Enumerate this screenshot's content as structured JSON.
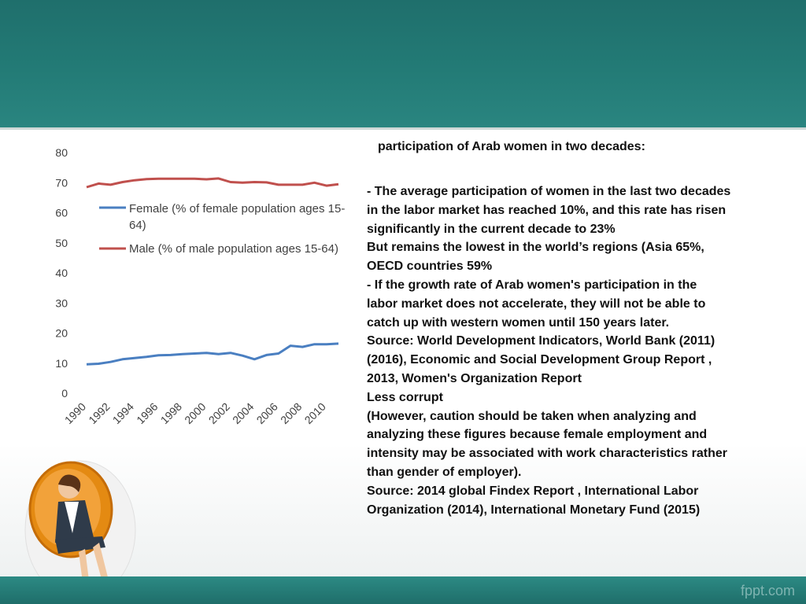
{
  "slide": {
    "heading": "participation of Arab women in two decades:",
    "body_lines": [
      "- The average participation of women in the last two decades",
      "in the labor market has reached 10%, and this rate has risen",
      "significantly in the current decade to 23%",
      "But remains the lowest in the world’s regions  (Asia 65%,",
      "OECD countries 59%",
      "- If the growth rate of Arab women's participation in the",
      "labor market does not accelerate, they will not be able to",
      "catch up with  western women  until 150 years later.",
      "Source: World Development Indicators, World Bank (2011)",
      "(2016),   Economic and Social Development Group Report ,",
      "2013,  Women's Organization Report",
      "Less corrupt",
      "(However, caution should be taken when analyzing and",
      "analyzing these figures because female employment and",
      "intensity may be associated with work characteristics rather",
      "than gender of employer).",
      "Source: 2014 global Findex Report , International Labor",
      "Organization (2014), International Monetary Fund (2015)"
    ],
    "footer_brand": "fppt.com"
  },
  "colors": {
    "header": "#237b76",
    "female_series": "#4a7fc1",
    "male_series": "#c0504d"
  },
  "chart_data": {
    "type": "line",
    "x": [
      1990,
      1991,
      1992,
      1993,
      1994,
      1995,
      1996,
      1997,
      1998,
      1999,
      2000,
      2001,
      2002,
      2003,
      2004,
      2005,
      2006,
      2007,
      2008,
      2009,
      2010,
      2011
    ],
    "x_tick_labels": [
      "1990",
      "1992",
      "1994",
      "1996",
      "1998",
      "2000",
      "2002",
      "2004",
      "2006",
      "2008",
      "2010"
    ],
    "y_tick_labels": [
      "0",
      "10",
      "20",
      "30",
      "40",
      "50",
      "60",
      "70",
      "80"
    ],
    "ylim": [
      0,
      80
    ],
    "grid": false,
    "legend_position": "upper-right",
    "series": [
      {
        "name": "Female (% of female population ages 15-64)",
        "legend_lines": [
          "Female (% of female population ages 15-",
          "64)"
        ],
        "values": [
          9.6,
          9.8,
          10.4,
          11.3,
          11.7,
          12.1,
          12.6,
          12.7,
          13.0,
          13.2,
          13.4,
          13.0,
          13.4,
          12.5,
          11.3,
          12.7,
          13.2,
          15.8,
          15.4,
          16.3,
          16.3,
          16.5
        ]
      },
      {
        "name": "Male (% of male population ages 15-64)",
        "legend_lines": [
          "Male (% of male population ages 15-64)"
        ],
        "values": [
          68.5,
          69.7,
          69.3,
          70.2,
          70.8,
          71.2,
          71.3,
          71.3,
          71.3,
          71.3,
          71.1,
          71.4,
          70.2,
          70.0,
          70.2,
          70.1,
          69.3,
          69.3,
          69.3,
          70.0,
          69.0,
          69.5
        ]
      }
    ]
  }
}
